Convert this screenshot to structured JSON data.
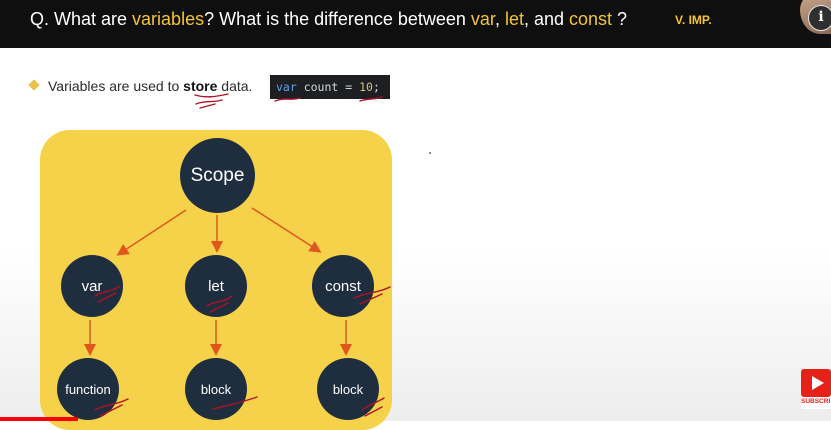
{
  "header": {
    "question_prefix": "Q. What are ",
    "question_var": "variables",
    "question_mid": "? What is the difference between ",
    "question_kw1": "var",
    "question_sep1": ", ",
    "question_kw2": "let",
    "question_sep2": ", and ",
    "question_kw3": "const",
    "question_suffix": " ?",
    "importance": "V. IMP.",
    "info_icon": "i"
  },
  "bullet": {
    "text_before": "Variables are used to ",
    "text_bold": "store",
    "text_after": " data.",
    "code_keyword": "var",
    "code_mid": " count = ",
    "code_number": "10",
    "code_end": ";"
  },
  "diagram": {
    "root": "Scope",
    "level1": [
      "var",
      "let",
      "const"
    ],
    "level2": [
      "function",
      "block",
      "block"
    ]
  },
  "youtube": {
    "label": "SUBSCRI"
  },
  "colors": {
    "panel": "#f5d24a",
    "node": "#1f2e3f",
    "arrow": "#e0561d",
    "annotation": "#b11226",
    "highlight": "#f4c536",
    "progress": "#ff0000",
    "subscribe": "#e62117"
  },
  "video": {
    "progress_fraction": 0.094
  }
}
